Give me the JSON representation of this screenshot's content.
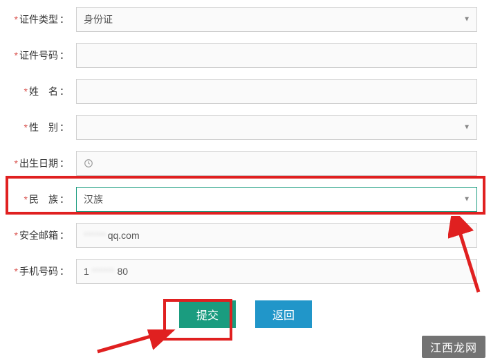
{
  "form": {
    "id_type": {
      "label": "证件类型",
      "value": "身份证"
    },
    "id_number": {
      "label": "证件号码",
      "value": ""
    },
    "name": {
      "label": "姓　名",
      "value": ""
    },
    "gender": {
      "label": "性　别",
      "value": ""
    },
    "birth_date": {
      "label": "出生日期",
      "value": ""
    },
    "ethnicity": {
      "label": "民　族",
      "value": "汉族"
    },
    "email": {
      "label": "安全邮箱",
      "value_suffix": "qq.com"
    },
    "phone": {
      "label": "手机号码",
      "value_prefix": "1",
      "value_suffix": "80"
    }
  },
  "buttons": {
    "submit": "提交",
    "back": "返回"
  },
  "watermark": "江西龙网"
}
